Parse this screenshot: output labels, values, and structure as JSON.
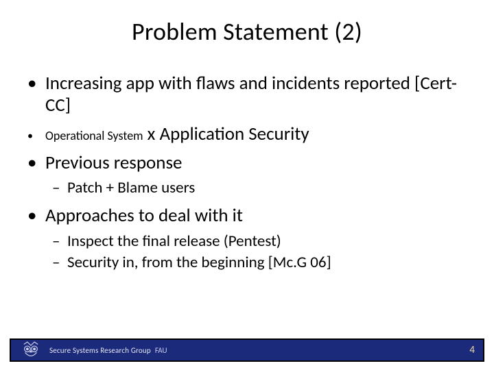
{
  "title": "Problem Statement (2)",
  "bullets": {
    "b1": "Increasing  app with flaws and incidents reported [Cert-CC]",
    "b2_small": "Operational System",
    "b2_rest": " x Application Security",
    "b3": "Previous response",
    "b3_1": "Patch + Blame users",
    "b4": "Approaches to deal with it",
    "b4_1": "Inspect the final release (Pentest)",
    "b4_2": "Security in, from the beginning [Mc.G 06]"
  },
  "footer": {
    "group": "Secure Systems Research Group",
    "inst": "FAU",
    "page": "4"
  }
}
